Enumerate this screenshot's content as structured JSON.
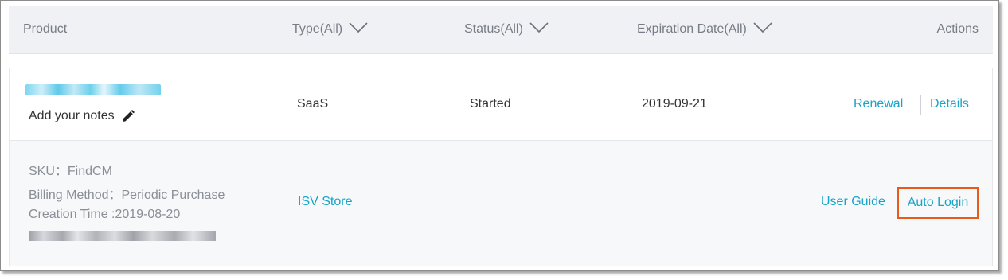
{
  "table": {
    "headers": {
      "product": "Product",
      "type": "Type(All)",
      "status": "Status(All)",
      "expiration": "Expiration Date(All)",
      "actions": "Actions"
    },
    "row": {
      "notes_label": "Add your notes",
      "type": "SaaS",
      "status": "Started",
      "expiration_date": "2019-09-21",
      "actions": {
        "renewal": "Renewal",
        "details": "Details"
      }
    },
    "sub_row": {
      "sku": "SKU：FindCM",
      "billing_method": "Billing Method：Periodic Purchase",
      "creation_time": "Creation Time :2019-08-20",
      "isv_store": "ISV Store",
      "user_guide": "User Guide",
      "auto_login": "Auto Login"
    }
  },
  "colors": {
    "link": "#1aa3c8",
    "header_bg": "#f0f1f5",
    "highlight_border": "#e8591a"
  },
  "icons": [
    "chevron-down-icon",
    "pencil-icon"
  ]
}
